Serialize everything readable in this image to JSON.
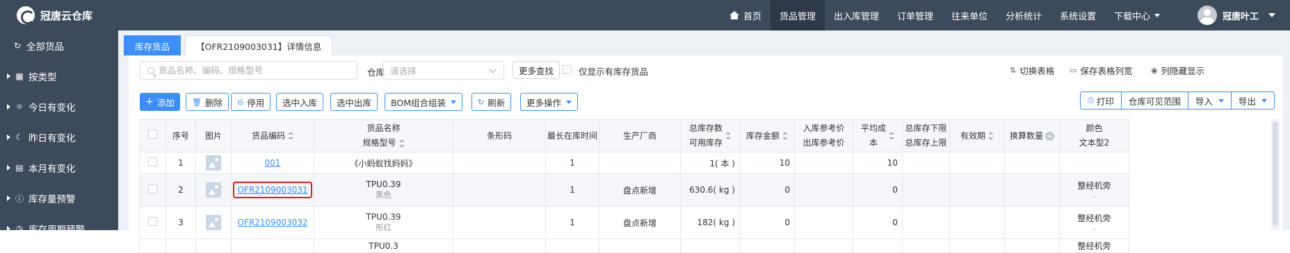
{
  "app": {
    "title": "冠唐云仓库"
  },
  "nav": {
    "home": "首页",
    "items": [
      {
        "label": "货品管理",
        "active": true
      },
      {
        "label": "出入库管理"
      },
      {
        "label": "订单管理"
      },
      {
        "label": "往来单位"
      },
      {
        "label": "分析统计"
      },
      {
        "label": "系统设置"
      },
      {
        "label": "下载中心"
      }
    ],
    "user": "冠唐叶工"
  },
  "sidebar": {
    "items": [
      {
        "label": "全部货品",
        "icon": "refresh-icon"
      },
      {
        "label": "按类型",
        "icon": "grid-icon"
      },
      {
        "label": "今日有变化",
        "icon": "sun-icon"
      },
      {
        "label": "昨日有变化",
        "icon": "moon-icon"
      },
      {
        "label": "本月有变化",
        "icon": "calendar-icon"
      },
      {
        "label": "库存量预警",
        "icon": "alert-icon"
      },
      {
        "label": "库存周期预警",
        "icon": "clock-icon"
      }
    ]
  },
  "tabs": [
    {
      "label": "库存货品",
      "active": true
    },
    {
      "label": "【OFR2109003031】详情信息"
    }
  ],
  "toolbar": {
    "search_placeholder": "货品名称、编码、规格型号",
    "warehouse_label": "仓库",
    "warehouse_placeholder": "请选择",
    "more_search": "更多查找",
    "show_all_label": "仅显示有库存货品",
    "switch_table": "切换表格",
    "save_columns": "保存表格列宽",
    "column_toggle": "列隐藏显示",
    "add": "添加",
    "delete": "删除",
    "disable": "停用",
    "select_in": "选中入库",
    "select_out": "选中出库",
    "bom": "BOM组合组装",
    "refresh": "刷新",
    "more_ops": "更多操作",
    "print": "打印",
    "visible_range": "仓库可见范围",
    "import": "导入",
    "export": "导出"
  },
  "table": {
    "headers": {
      "seq": "序号",
      "image": "图片",
      "code": "货品编码",
      "name1": "货品名称",
      "name2": "规格型号",
      "barcode": "条形码",
      "longest": "最长在库时间",
      "manufacturer": "生产厂商",
      "stock1": "总库存数",
      "stock2": "可用库存",
      "amount": "库存金额",
      "price1": "入库参考价",
      "price2": "出库参考价",
      "cost1": "平均成",
      "cost2": "本",
      "limit1": "总库存下限",
      "limit2": "总库存上限",
      "validity": "有效期",
      "convert": "换算数量",
      "color1": "颜色",
      "color2": "文本型2"
    },
    "rows": [
      {
        "seq": "1",
        "code": "001",
        "name": "《小蚂蚁找妈妈》",
        "spec": "",
        "barcode": "",
        "longest": "1",
        "manufacturer": "",
        "stock": "1( 本 )",
        "amount": "10",
        "price": "",
        "cost": "10",
        "limit": "",
        "validity": "",
        "convert": "",
        "color": "",
        "text2": ""
      },
      {
        "seq": "2",
        "code": "OFR2109003031",
        "name": "TPU0.39",
        "spec": "黑色",
        "barcode": "",
        "longest": "1",
        "manufacturer": "盘点新增",
        "stock": "630.6( kg )",
        "amount": "0",
        "price": "",
        "cost": "0",
        "limit": "",
        "validity": "",
        "convert": "",
        "color": "整经机旁",
        "text2": "-"
      },
      {
        "seq": "3",
        "code": "OFR2109003032",
        "name": "TPU0.39",
        "spec": "彤红",
        "barcode": "",
        "longest": "1",
        "manufacturer": "盘点新增",
        "stock": "182( kg )",
        "amount": "0",
        "price": "",
        "cost": "0",
        "limit": "",
        "validity": "",
        "convert": "",
        "color": "整经机旁",
        "text2": "-"
      },
      {
        "seq": "",
        "code": "",
        "name": "TPU0.3",
        "spec": "",
        "barcode": "",
        "longest": "",
        "manufacturer": "",
        "stock": "",
        "amount": "",
        "price": "",
        "cost": "",
        "limit": "",
        "validity": "",
        "convert": "",
        "color": "整经机旁",
        "text2": ""
      }
    ]
  },
  "colors": {
    "accent": "#3e8ef7",
    "nav_bg": "#3d4a5c",
    "highlight": "#e01b1b"
  }
}
